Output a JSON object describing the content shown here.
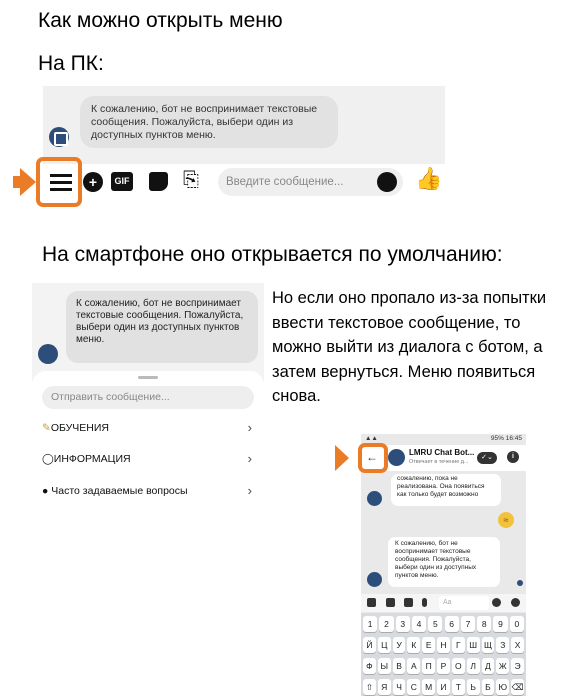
{
  "headings": {
    "title": "Как можно открыть меню",
    "pc": "На ПК:",
    "smartphone": "На смартфоне оно открывается по умолчанию:"
  },
  "note": "Но если оно пропало из-за попытки ввести текстовое сообщение, то можно выйти из диалога с ботом, а затем вернуться. Меню появиться снова.",
  "pc_screenshot": {
    "bot_message": "К сожалению, бот не воспринимает текстовые сообщения. Пожалуйста, выбери один из доступных пунктов меню.",
    "toolbar": {
      "gif_label": "GIF",
      "input_placeholder": "Введите сообщение..."
    }
  },
  "smartphone_screenshot": {
    "bot_message": "К сожалению, бот не воспринимает текстовые сообщения. Пожалуйста, выбери один из доступных пунктов меню.",
    "input_placeholder": "Отправить сообщение...",
    "menu_items": [
      {
        "label": "ОБУЧЕНИЯ",
        "icon": "graduation-icon"
      },
      {
        "label": "ИНФОРМАЦИЯ",
        "icon": "circle-icon"
      },
      {
        "label": "Часто задаваемые вопросы",
        "icon": "dot-icon"
      }
    ]
  },
  "phone_screenshot": {
    "status_time": "16:45",
    "status_battery": "95%",
    "chat_title": "LMRU Chat Bot...",
    "chat_subtitle": "Отвечает в течение д...",
    "message_1": "сожалению, пока не реализована. Она появиться как только будет возможно",
    "message_2": "К сожалению, бот не воспринимает текстовые сообщения. Пожалуйста, выбери один из доступных пунктов меню.",
    "input_placeholder": "Aa",
    "keyboard_rows": [
      [
        "1",
        "2",
        "3",
        "4",
        "5",
        "6",
        "7",
        "8",
        "9",
        "0"
      ],
      [
        "Й",
        "Ц",
        "У",
        "К",
        "Е",
        "Н",
        "Г",
        "Ш",
        "Щ",
        "З",
        "Х"
      ],
      [
        "Ф",
        "Ы",
        "В",
        "А",
        "П",
        "Р",
        "О",
        "Л",
        "Д",
        "Ж",
        "Э"
      ],
      [
        "⇧",
        "Я",
        "Ч",
        "С",
        "М",
        "И",
        "Т",
        "Ь",
        "Б",
        "Ю",
        "⌫"
      ]
    ]
  },
  "colors": {
    "highlight": "#ea7b27",
    "avatar": "#2d4e7a"
  }
}
